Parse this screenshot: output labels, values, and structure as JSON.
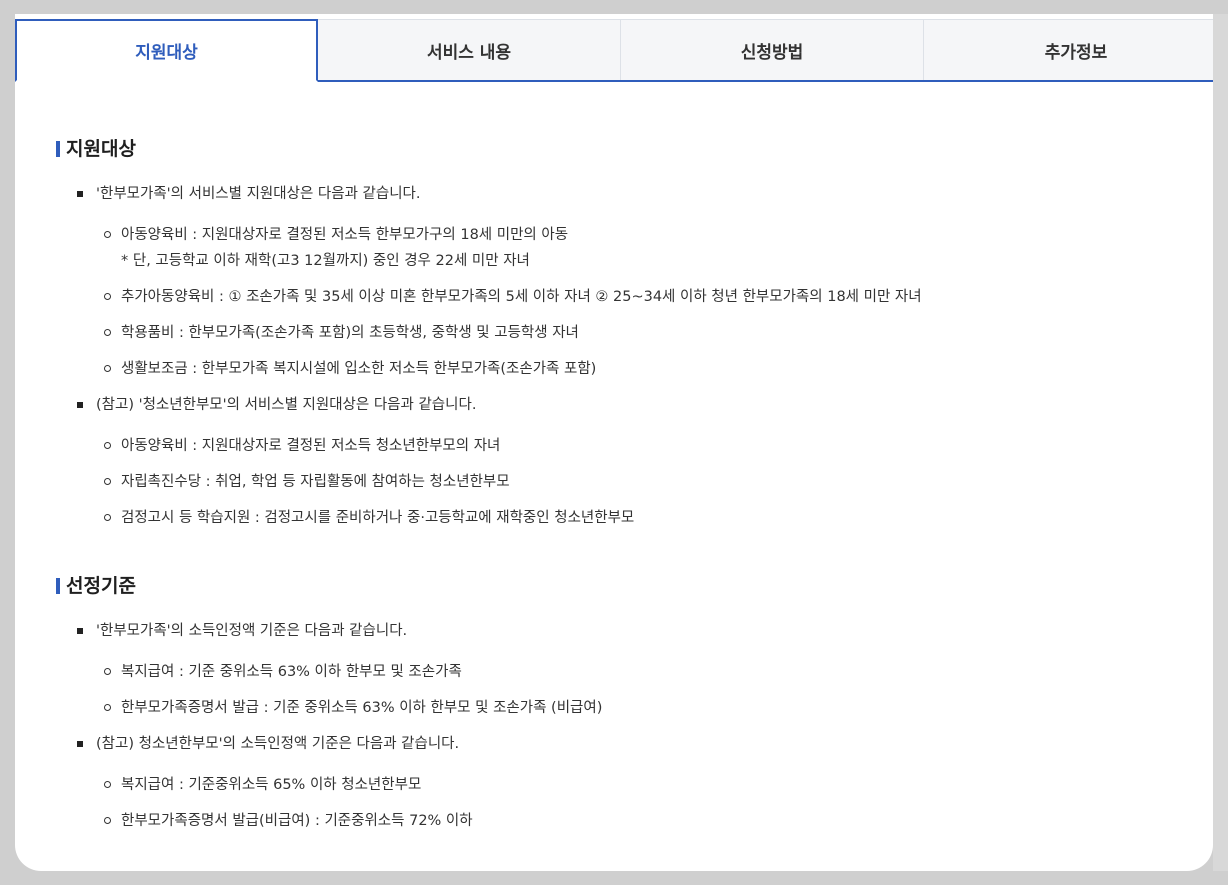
{
  "tabs": [
    {
      "label": "지원대상",
      "active": true
    },
    {
      "label": "서비스 내용",
      "active": false
    },
    {
      "label": "신청방법",
      "active": false
    },
    {
      "label": "추가정보",
      "active": false
    }
  ],
  "sections": {
    "support": {
      "title": "지원대상",
      "group1": {
        "heading": "'한부모가족'의 서비스별 지원대상은 다음과 같습니다.",
        "items": [
          "아동양육비 : 지원대상자로 결정된 저소득 한부모가구의 18세 미만의 아동",
          "추가아동양육비 : ① 조손가족 및 35세 이상 미혼 한부모가족의 5세 이하 자녀 ② 25~34세 이하 청년 한부모가족의 18세 미만 자녀",
          "학용품비 : 한부모가족(조손가족 포함)의 초등학생, 중학생 및 고등학생 자녀",
          "생활보조금 : 한부모가족 복지시설에 입소한 저소득 한부모가족(조손가족 포함)"
        ],
        "note": "* 단, 고등학교 이하 재학(고3 12월까지) 중인 경우 22세 미만 자녀"
      },
      "group2": {
        "heading": "(참고) '청소년한부모'의 서비스별 지원대상은 다음과 같습니다.",
        "items": [
          "아동양육비 : 지원대상자로 결정된 저소득 청소년한부모의 자녀",
          "자립촉진수당 : 취업, 학업 등 자립활동에 참여하는 청소년한부모",
          "검정고시 등 학습지원 : 검정고시를 준비하거나 중·고등학교에 재학중인 청소년한부모"
        ]
      }
    },
    "criteria": {
      "title": "선정기준",
      "group1": {
        "heading": "'한부모가족'의 소득인정액 기준은 다음과 같습니다.",
        "items": [
          "복지급여 : 기준 중위소득 63% 이하 한부모 및 조손가족",
          "한부모가족증명서 발급 : 기준 중위소득 63% 이하 한부모 및 조손가족 (비급여)"
        ]
      },
      "group2": {
        "heading": "(참고) 청소년한부모'의 소득인정액 기준은 다음과 같습니다.",
        "items": [
          "복지급여 : 기준중위소득 65% 이하 청소년한부모",
          "한부모가족증명서 발급(비급여) : 기준중위소득 72% 이하"
        ]
      }
    }
  },
  "colors": {
    "accent": "#2f5dbc",
    "tab_bg": "#f5f6f8",
    "page_bg": "#cfcfcf"
  }
}
